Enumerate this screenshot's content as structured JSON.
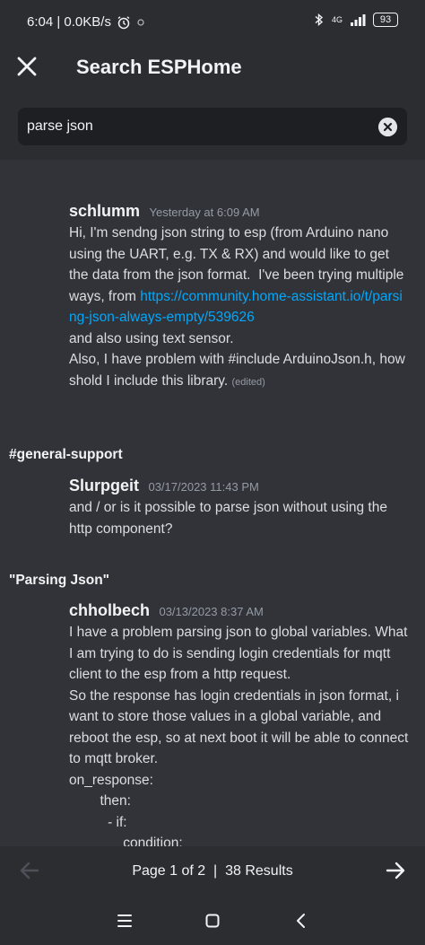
{
  "status": {
    "time_speed": "6:04 | 0.0KB/s",
    "network": "4G",
    "battery": "93"
  },
  "header": {
    "title": "Search ESPHome"
  },
  "search": {
    "query": "parse json"
  },
  "messages": [
    {
      "author": "schlumm",
      "timestamp": "Yesterday at 6:09 AM",
      "text_before": "Hi, I'm sendng json string to esp (from Arduino nano using the UART, e.g. TX & RX) and would like to get the data from the json format.  I've been trying multiple ways, from ",
      "link": "https://community.home-assistant.io/t/parsing-json-always-empty/539626",
      "text_after": "\nand also using text sensor.\nAlso, I have problem with #include ArduinoJson.h, how shold I include this library.",
      "edited": "(edited)"
    },
    {
      "channel": "#general-support",
      "author": "Slurpgeit",
      "timestamp": "03/17/2023 11:43 PM",
      "text": "and / or is it possible to parse json without using the http component?"
    },
    {
      "channel": "\"Parsing Json\"",
      "author": "chholbech",
      "timestamp": "03/13/2023 8:37 AM",
      "text": "I have a problem parsing json to global variables. What I am trying to do is sending login credentials for mqtt client to the esp from a http request.\nSo the response has login credentials in json format, i want to store those values in a global variable, and reboot the esp, so at next boot it will be able to connect to mqtt broker.\non_response:\n        then:\n          - if:\n              condition:"
    }
  ],
  "pager": {
    "text": "Page 1 of 2  |  38 Results"
  },
  "icons": {
    "close": "close-icon",
    "clear": "clear-icon",
    "prev": "arrow-left-icon",
    "next": "arrow-right-icon",
    "recents": "menu-icon",
    "home": "square-icon",
    "back": "chevron-left-icon"
  },
  "colors": {
    "background": "#313338",
    "link": "#00a8fc",
    "muted": "#949ba4"
  }
}
